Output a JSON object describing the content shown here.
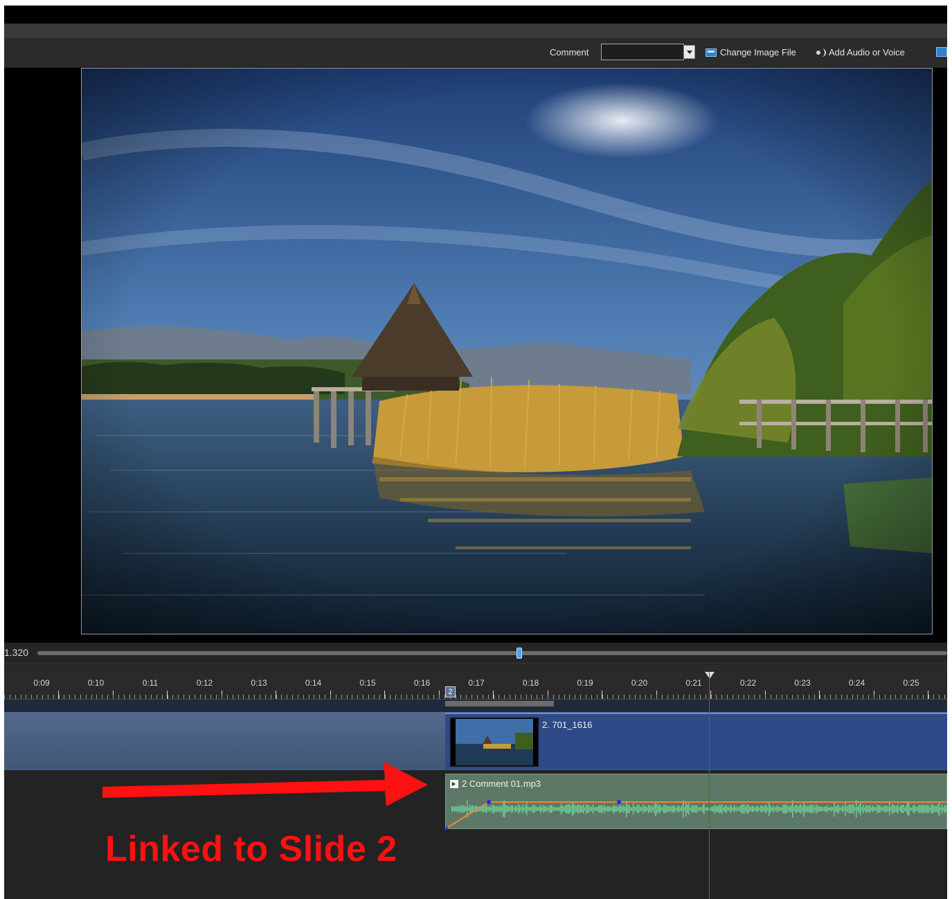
{
  "toolbar": {
    "comment_label": "Comment",
    "comment_value": "",
    "change_image_label": "Change Image File",
    "add_audio_label": "Add Audio or Voice"
  },
  "scrubber": {
    "value_text": "1.320",
    "position_fraction": 0.53
  },
  "ruler": {
    "labels": [
      "0:09",
      "0:10",
      "0:11",
      "0:12",
      "0:13",
      "0:14",
      "0:15",
      "0:16",
      "0:17",
      "0:18",
      "0:19",
      "0:20",
      "0:21",
      "0:22",
      "0:23",
      "0:24",
      "0:25"
    ],
    "slide_marker": "2"
  },
  "slide_clip": {
    "name": "2. 701_1616"
  },
  "audio_clip": {
    "name": "2  Comment 01.mp3"
  },
  "annotation": {
    "caption": "Linked to Slide 2",
    "color": "#ff1111"
  },
  "colors": {
    "slide_clip": "#2e4a86",
    "audio_clip": "#5d7866",
    "waveform": "#6fd39a",
    "volume_line": "#e88a3a",
    "playhead": "#c0392b"
  },
  "icons": [
    "dropdown-arrow-icon",
    "image-file-icon",
    "audio-voice-icon",
    "next-icon",
    "audio-clip-icon"
  ]
}
